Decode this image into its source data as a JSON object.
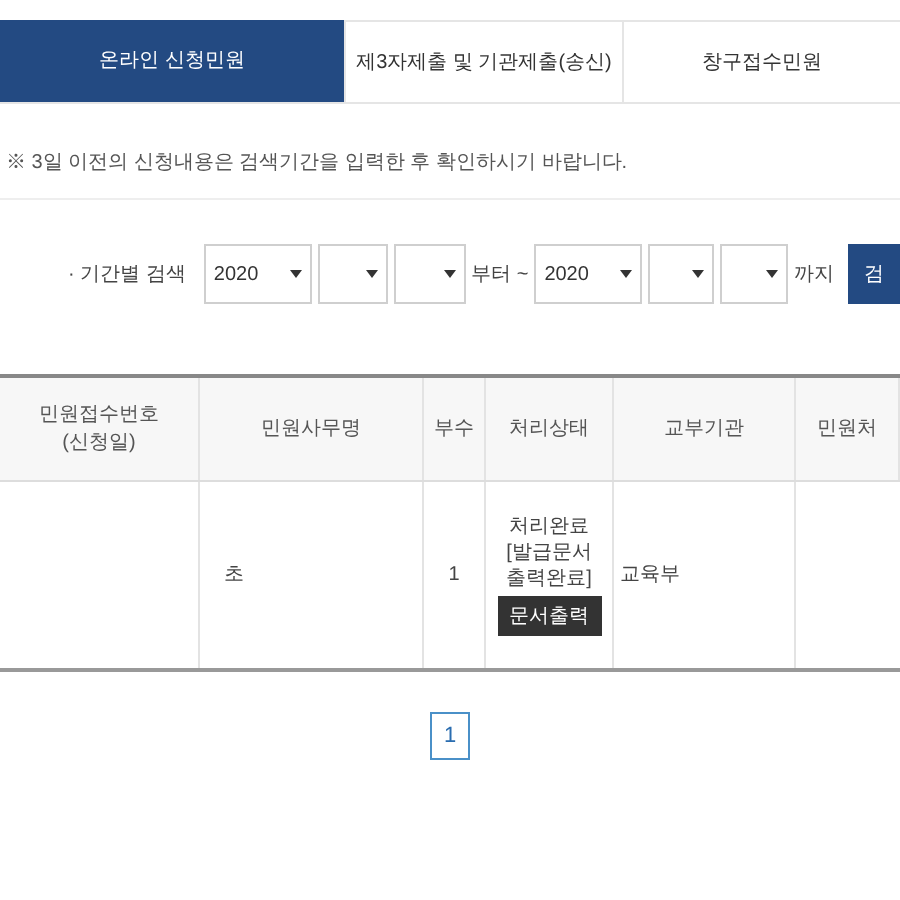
{
  "tabs": [
    {
      "label": "온라인 신청민원",
      "selected": true
    },
    {
      "label": "제3자제출 및 기관제출(송신)",
      "selected": false
    },
    {
      "label": "창구접수민원",
      "selected": false
    }
  ],
  "notice": "※ 3일 이전의 신청내용은 검색기간을 입력한 후 확인하시기 바랍니다.",
  "period_search": {
    "label": "· 기간별 검색",
    "from_year": "2020",
    "from_text": "부터 ~",
    "to_year": "2020",
    "to_text": "까지",
    "button": "검"
  },
  "table": {
    "columns": [
      "민원접수번호\n(신청일)",
      "민원사무명",
      "부수",
      "처리상태",
      "교부기관",
      "민원처"
    ],
    "rows": [
      {
        "name": "초",
        "copies": "1",
        "status": "처리완료\n[발급문서\n출력완료]",
        "print_button": "문서출력",
        "agency": "교육부"
      }
    ]
  },
  "pagination": [
    {
      "label": "1",
      "selected": true
    }
  ]
}
